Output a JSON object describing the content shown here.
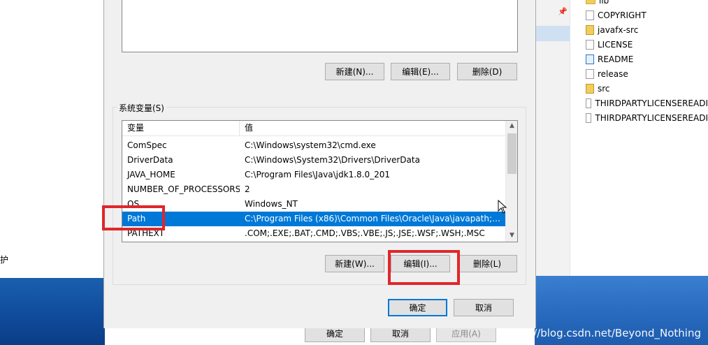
{
  "left_text": "护",
  "explorer": {
    "files": [
      {
        "name": "lib",
        "icon": "folder-icon"
      },
      {
        "name": "COPYRIGHT",
        "icon": "file-icon"
      },
      {
        "name": "javafx-src",
        "icon": "zip-icon"
      },
      {
        "name": "LICENSE",
        "icon": "file-icon"
      },
      {
        "name": "README",
        "icon": "ie-file-icon"
      },
      {
        "name": "release",
        "icon": "file-icon"
      },
      {
        "name": "src",
        "icon": "zip-icon"
      },
      {
        "name": "THIRDPARTYLICENSEREADI",
        "icon": "file-icon"
      },
      {
        "name": "THIRDPARTYLICENSEREADI",
        "icon": "file-icon"
      }
    ],
    "pin_glyph": "📌"
  },
  "user_vars": {
    "new_label": "新建(N)...",
    "edit_label": "编辑(E)...",
    "delete_label": "删除(D)"
  },
  "system_vars": {
    "group_label": "系统变量(S)",
    "col_variable": "变量",
    "col_value": "值",
    "rows": [
      {
        "name": "ComSpec",
        "value": "C:\\Windows\\system32\\cmd.exe"
      },
      {
        "name": "DriverData",
        "value": "C:\\Windows\\System32\\Drivers\\DriverData"
      },
      {
        "name": "JAVA_HOME",
        "value": "C:\\Program Files\\Java\\jdk1.8.0_201"
      },
      {
        "name": "NUMBER_OF_PROCESSORS",
        "value": "2"
      },
      {
        "name": "OS",
        "value": "Windows_NT"
      },
      {
        "name": "Path",
        "value": "C:\\Program Files (x86)\\Common Files\\Oracle\\Java\\javapath;C:..."
      },
      {
        "name": "PATHEXT",
        "value": ".COM;.EXE;.BAT;.CMD;.VBS;.VBE;.JS;.JSE;.WSF;.WSH;.MSC"
      }
    ],
    "selected": "Path",
    "new_label": "新建(W)...",
    "edit_label": "编辑(I)...",
    "delete_label": "删除(L)"
  },
  "dialog_buttons": {
    "ok_label": "确定",
    "cancel_label": "取消"
  },
  "underlying_buttons": {
    "ok_label": "确定",
    "cancel_label": "取消",
    "apply_label": "应用(A)"
  },
  "watermark": "https://blog.csdn.net/Beyond_Nothing",
  "colors": {
    "selection": "#0078d7",
    "highlight": "#e0262b",
    "dialog_bg": "#f0f0f0"
  }
}
